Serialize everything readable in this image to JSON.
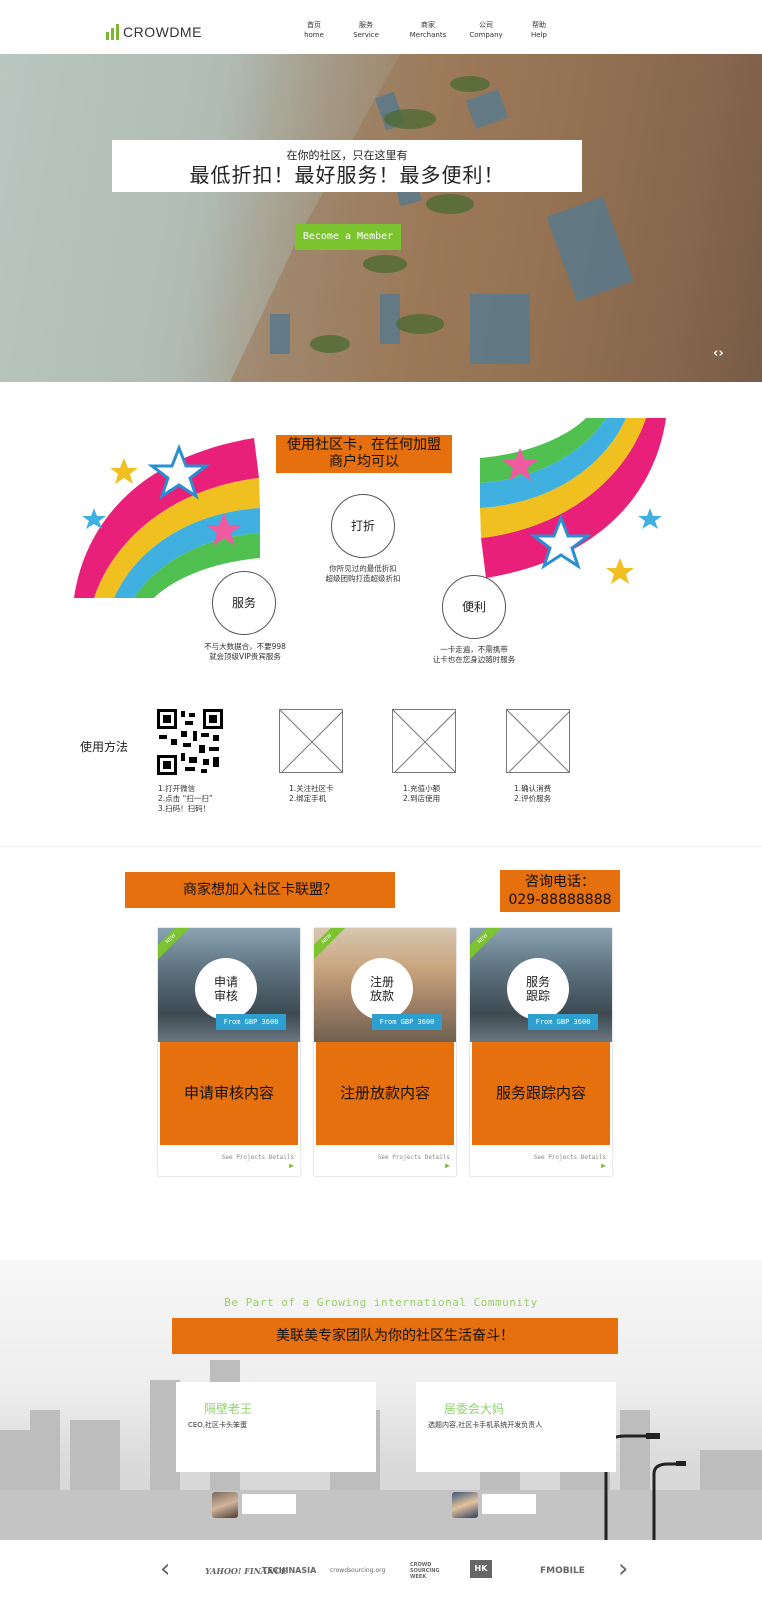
{
  "header": {
    "logo": "CROWDME",
    "nav": [
      {
        "zh": "首页",
        "en": "home"
      },
      {
        "zh": "服务",
        "en": "Service"
      },
      {
        "zh": "商家",
        "en": "Merchants"
      },
      {
        "zh": "公司",
        "en": "Company"
      },
      {
        "zh": "帮助",
        "en": "Help"
      }
    ]
  },
  "hero": {
    "subtitle": "在你的社区，只在这里有",
    "title": "最低折扣！最好服务！最多便利！",
    "cta": "Become a Member",
    "arrows": "‹›"
  },
  "features": {
    "title_line1": "使用社区卡，在任何加盟",
    "title_line2": "商户均可以",
    "items": [
      {
        "label": "打折",
        "desc1": "你所见过的最低折扣",
        "desc2": "超级团购打造超级折扣"
      },
      {
        "label": "服务",
        "desc1": "不与大数据合，不要998",
        "desc2": "就会顶级VIP贵宾服务"
      },
      {
        "label": "便利",
        "desc1": "一卡走遍，不需携带",
        "desc2": "让卡也在您身边随时服务"
      }
    ]
  },
  "usage": {
    "label": "使用方法",
    "steps": [
      [
        "1.打开微信",
        "2.点击 “扫一扫”",
        "3.扫码！扫码！"
      ],
      [
        "1.关注社区卡",
        "2.绑定手机"
      ],
      [
        "1.充值小额",
        "2.到店使用"
      ],
      [
        "1.确认消费",
        "2.评价服务"
      ]
    ]
  },
  "merchant": {
    "banner": "商家想加入社区卡联盟？",
    "phone_label": "咨询电话：",
    "phone": "029-88888888",
    "cards": [
      {
        "ribbon": "NEW",
        "circle_line1": "申请",
        "circle_line2": "审核",
        "price": "From GBP 3600",
        "body": "申请审核内容",
        "link": "See Projects Details"
      },
      {
        "ribbon": "NEW",
        "circle_line1": "注册",
        "circle_line2": "放款",
        "price": "From GBP 3600",
        "body": "注册放款内容",
        "link": "See Projects Details"
      },
      {
        "ribbon": "NEW",
        "circle_line1": "服务",
        "circle_line2": "跟踪",
        "price": "From GBP 3600",
        "body": "服务跟踪内容",
        "link": "See Projects Details"
      }
    ]
  },
  "team": {
    "heading": "Be Part of a Growing international Community",
    "banner": "美联美专家团队为你的社区生活奋斗！",
    "testimonials": [
      {
        "name": "隔壁老王",
        "text": "CEO,社区卡头笨蛋"
      },
      {
        "name": "居委会大妈",
        "text": "选题内容,社区卡手机系统开发负责人"
      }
    ]
  },
  "partners": [
    "YAHOO! FINANCE",
    "TECHINASIA",
    "crowdsourcing.org",
    "CROWD SOURCING WEEK",
    "HK",
    "FMOBILE"
  ],
  "colors": {
    "accent_green": "#7cc42f",
    "orange": "#e5700d",
    "price_blue": "#2f9fd0"
  }
}
